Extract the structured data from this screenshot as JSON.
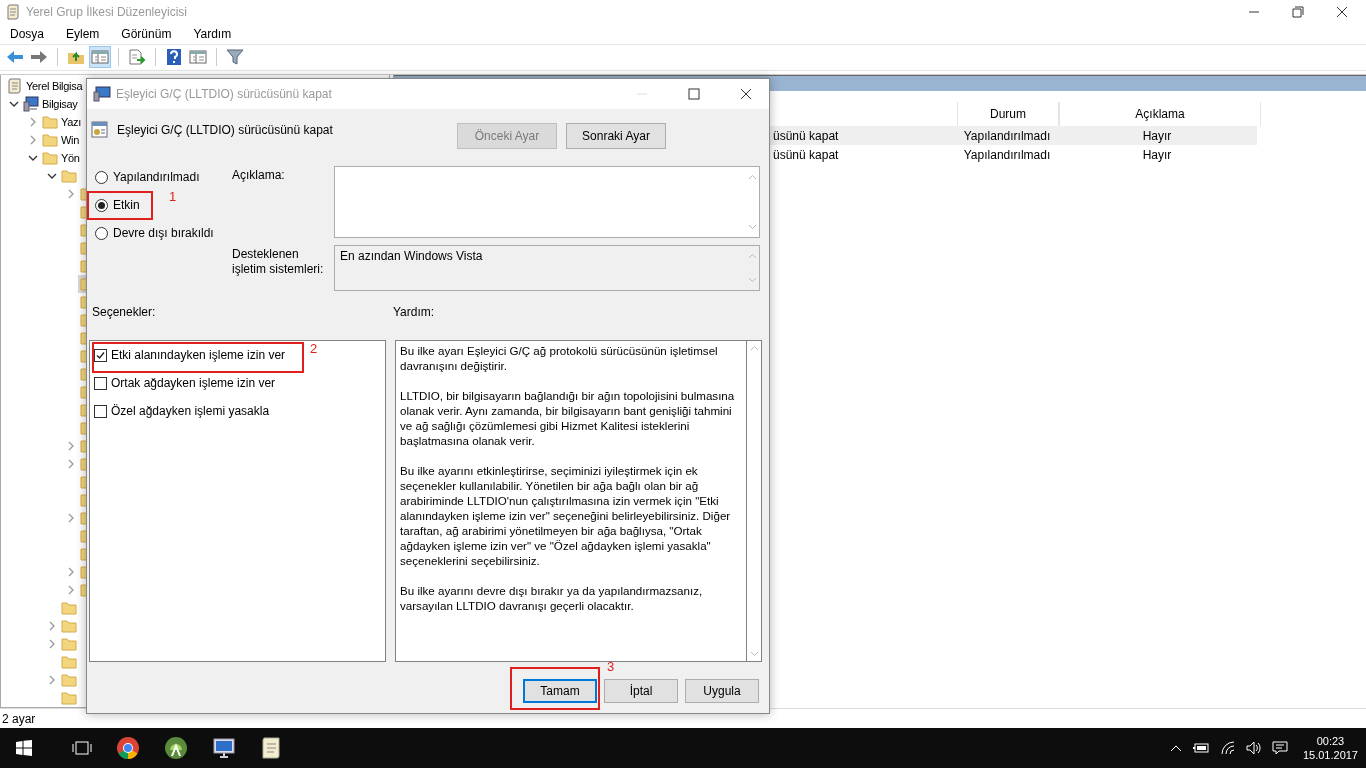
{
  "window": {
    "title": "Yerel Grup İlkesi Düzenleyicisi"
  },
  "menu": [
    "Dosya",
    "Eylem",
    "Görünüm",
    "Yardım"
  ],
  "toolbar": [
    {
      "kind": "back",
      "pressed": false
    },
    {
      "kind": "forward",
      "pressed": false
    },
    {
      "kind": "sep"
    },
    {
      "kind": "up",
      "pressed": false
    },
    {
      "kind": "tree",
      "pressed": true
    },
    {
      "kind": "sep"
    },
    {
      "kind": "export",
      "pressed": false
    },
    {
      "kind": "sep"
    },
    {
      "kind": "help",
      "pressed": false
    },
    {
      "kind": "pane",
      "pressed": false
    },
    {
      "kind": "sep"
    },
    {
      "kind": "filter",
      "pressed": false
    }
  ],
  "tree": [
    {
      "label": "Yerel Bilgisa",
      "kind": "policy",
      "selected": false,
      "children": [
        {
          "label": "Bilgisay",
          "kind": "computer",
          "expanded": true,
          "selected": false,
          "children": [
            {
              "label": "Yazı",
              "kind": "folder",
              "expanded": false,
              "selected": false
            },
            {
              "label": "Win",
              "kind": "folder",
              "expanded": false,
              "selected": false
            },
            {
              "label": "Yön",
              "kind": "folder",
              "expanded": true,
              "selected": false,
              "children": [
                {
                  "kind": "folder",
                  "expanded": true,
                  "selected": false,
                  "children": [
                    {
                      "kind": "folder",
                      "expanded": false,
                      "selected": false
                    },
                    {
                      "kind": "folder",
                      "selected": false
                    },
                    {
                      "kind": "folder",
                      "selected": false
                    },
                    {
                      "kind": "folder",
                      "selected": false
                    },
                    {
                      "kind": "folder",
                      "selected": false
                    },
                    {
                      "kind": "folder",
                      "selected": true
                    },
                    {
                      "kind": "folder",
                      "selected": false
                    },
                    {
                      "kind": "folder",
                      "selected": false
                    },
                    {
                      "kind": "folder",
                      "selected": false
                    },
                    {
                      "kind": "folder",
                      "selected": false
                    },
                    {
                      "kind": "folder",
                      "selected": false
                    },
                    {
                      "kind": "folder",
                      "selected": false
                    },
                    {
                      "kind": "folder",
                      "selected": false
                    },
                    {
                      "kind": "folder",
                      "selected": false
                    },
                    {
                      "kind": "folder",
                      "expanded": false,
                      "selected": false
                    },
                    {
                      "kind": "folder",
                      "expanded": false,
                      "selected": false
                    },
                    {
                      "kind": "folder",
                      "selected": false
                    },
                    {
                      "kind": "folder",
                      "selected": false
                    },
                    {
                      "kind": "folder",
                      "expanded": false,
                      "selected": false
                    },
                    {
                      "kind": "folder",
                      "selected": false
                    },
                    {
                      "kind": "folder",
                      "selected": false
                    },
                    {
                      "kind": "folder",
                      "expanded": false,
                      "selected": false
                    },
                    {
                      "kind": "folder",
                      "expanded": false,
                      "selected": false
                    }
                  ]
                },
                {
                  "kind": "folder",
                  "selected": false
                },
                {
                  "kind": "folder",
                  "expanded": false,
                  "selected": false
                },
                {
                  "kind": "folder",
                  "expanded": false,
                  "selected": false
                },
                {
                  "kind": "folder",
                  "selected": false
                },
                {
                  "kind": "folder",
                  "expanded": false,
                  "selected": false
                },
                {
                  "kind": "folder",
                  "selected": false
                }
              ]
            }
          ]
        }
      ]
    }
  ],
  "list": {
    "columns": [
      "Durum",
      "Açıklama"
    ],
    "rows": [
      {
        "name": "üsünü kapat",
        "state": "Yapılandırılmadı",
        "comment": "Hayır",
        "selected": true
      },
      {
        "name": "üsünü kapat",
        "state": "Yapılandırılmadı",
        "comment": "Hayır",
        "selected": false
      }
    ]
  },
  "status_bar": "2 ayar",
  "dialog": {
    "title": "Eşleyici G/Ç (LLTDIO) sürücüsünü kapat",
    "heading": "Eşleyici G/Ç (LLTDIO) sürücüsünü kapat",
    "nav_buttons": [
      {
        "label": "Önceki Ayar",
        "disabled": true
      },
      {
        "label": "Sonraki Ayar",
        "disabled": false
      }
    ],
    "radios": [
      {
        "label": "Yapılandırılmadı",
        "selected": false
      },
      {
        "label": "Etkin",
        "selected": true,
        "callout": "1"
      },
      {
        "label": "Devre dışı bırakıldı",
        "selected": false
      }
    ],
    "comment_label": "Açıklama:",
    "supported_label": "Desteklenen işletim sistemleri:",
    "supported_value": "En azından Windows Vista",
    "options_label": "Seçenekler:",
    "help_label": "Yardım:",
    "options": [
      {
        "label": "Etki alanındayken işleme izin ver",
        "checked": true,
        "callout": "2"
      },
      {
        "label": "Ortak ağdayken işleme izin ver",
        "checked": false
      },
      {
        "label": "Özel ağdayken işlemi yasakla",
        "checked": false
      }
    ],
    "help": [
      "Bu ilke ayarı Eşleyici G/Ç ağ protokolü sürücüsünün işletimsel davranışını değiştirir.",
      "LLTDIO, bir bilgisayarın bağlandığı bir ağın topolojisini bulmasına olanak verir. Aynı zamanda, bir bilgisayarın bant genişliği tahmini ve ağ sağlığı çözümlemesi gibi Hizmet Kalitesi isteklerini başlatmasına olanak verir.",
      "Bu ilke ayarını etkinleştirirse, seçiminizi iyileştirmek için ek seçenekler kullanılabilir. Yönetilen bir ağa bağlı olan bir ağ arabiriminde LLTDIO'nun çalıştırılmasına izin vermek için \"Etki alanındayken işleme izin ver\" seçeneğini belirleyebilirsiniz. Diğer taraftan, ağ arabirimi yönetilmeyen bir ağa bağlıysa, \"Ortak ağdayken işleme izin ver\" ve \"Özel ağdayken işlemi yasakla\" seçeneklerini seçebilirsiniz.",
      "Bu ilke ayarını devre dışı bırakır ya da yapılandırmazsanız, varsayılan LLTDIO davranışı geçerli olacaktır."
    ],
    "actions": [
      {
        "label": "Tamam",
        "default": true,
        "callout": "3"
      },
      {
        "label": "İptal",
        "default": false
      },
      {
        "label": "Uygula",
        "default": false
      }
    ]
  },
  "taskbar": {
    "time": "00:23",
    "date": "15.01.2017"
  }
}
